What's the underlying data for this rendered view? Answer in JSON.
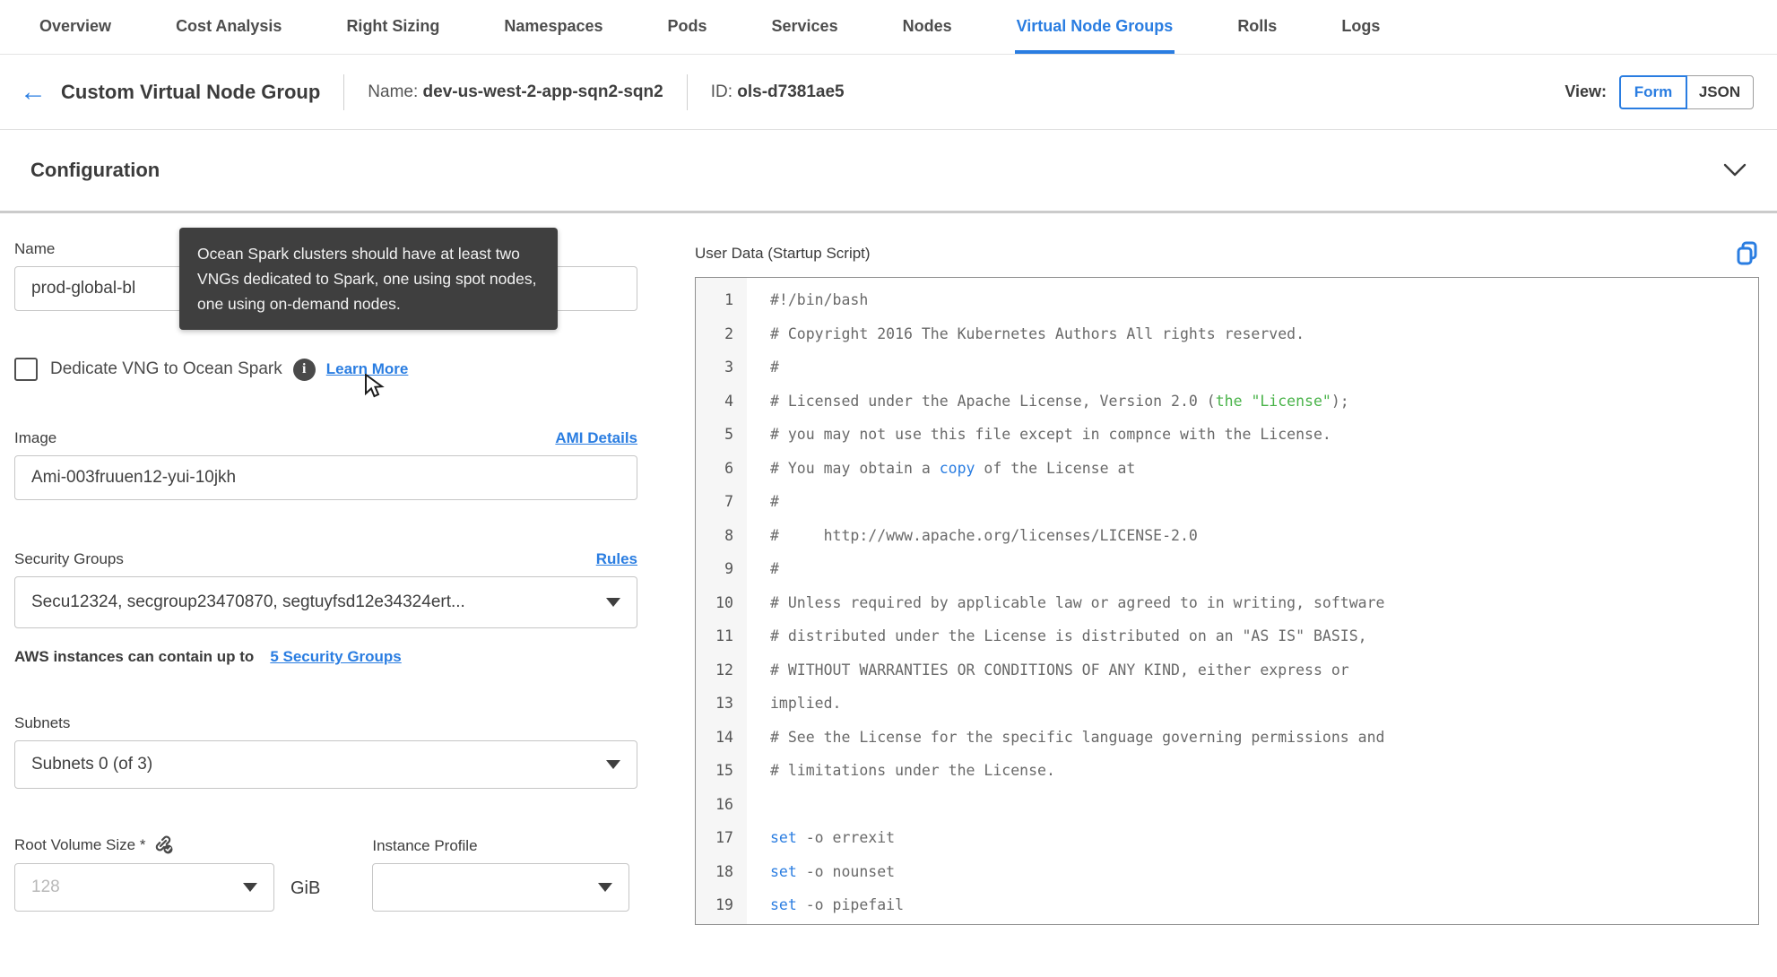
{
  "tabs": {
    "items": [
      {
        "label": "Overview",
        "active": false
      },
      {
        "label": "Cost Analysis",
        "active": false
      },
      {
        "label": "Right Sizing",
        "active": false
      },
      {
        "label": "Namespaces",
        "active": false
      },
      {
        "label": "Pods",
        "active": false
      },
      {
        "label": "Services",
        "active": false
      },
      {
        "label": "Nodes",
        "active": false
      },
      {
        "label": "Virtual Node Groups",
        "active": true
      },
      {
        "label": "Rolls",
        "active": false
      },
      {
        "label": "Logs",
        "active": false
      }
    ]
  },
  "header": {
    "title": "Custom Virtual Node Group",
    "name_label": "Name:",
    "name_value": "dev-us-west-2-app-sqn2-sqn2",
    "id_label": "ID:",
    "id_value": "ols-d7381ae5",
    "view_label": "View:",
    "view_options": [
      {
        "label": "Form",
        "active": true
      },
      {
        "label": "JSON",
        "active": false
      }
    ]
  },
  "section": {
    "title": "Configuration"
  },
  "form": {
    "name": {
      "label": "Name",
      "value": "prod-global-bl"
    },
    "tooltip": {
      "text": "Ocean Spark clusters should have at least two VNGs dedicated to Spark, one using spot nodes, one using on-demand nodes."
    },
    "dedicate": {
      "label": "Dedicate VNG to Ocean Spark",
      "checked": false,
      "link": "Learn More"
    },
    "image": {
      "label": "Image",
      "link": "AMI Details",
      "value": "Ami-003fruuen12-yui-10jkh"
    },
    "security_groups": {
      "label": "Security Groups",
      "link": "Rules",
      "value": "Secu12324, secgroup23470870, segtuyfsd12e34324ert...",
      "helper_text": "AWS instances can contain up to",
      "helper_link": "5 Security Groups"
    },
    "subnets": {
      "label": "Subnets",
      "value": "Subnets 0 (of 3)"
    },
    "root_volume": {
      "label": "Root Volume Size *",
      "placeholder": "128",
      "unit": "GiB"
    },
    "instance_profile": {
      "label": "Instance Profile",
      "value": ""
    }
  },
  "editor": {
    "title": "User Data (Startup Script)",
    "copy_icon": "copy-icon",
    "lines": [
      {
        "n": 1,
        "s": [
          {
            "t": "#!/bin/bash",
            "c": "d"
          }
        ]
      },
      {
        "n": 2,
        "s": [
          {
            "t": "# Copyright 2016 The Kubernetes Authors All rights reserved.",
            "c": "d"
          }
        ]
      },
      {
        "n": 3,
        "s": [
          {
            "t": "#",
            "c": "d"
          }
        ]
      },
      {
        "n": 4,
        "s": [
          {
            "t": "# Licensed under the Apache License, Version 2.0 (",
            "c": "d"
          },
          {
            "t": "the \"License\"",
            "c": "g"
          },
          {
            "t": ");",
            "c": "d"
          }
        ]
      },
      {
        "n": 5,
        "s": [
          {
            "t": "# you may not use this file except in compnce with the License.",
            "c": "d"
          }
        ]
      },
      {
        "n": 6,
        "s": [
          {
            "t": "# You may obtain a ",
            "c": "d"
          },
          {
            "t": "copy",
            "c": "b"
          },
          {
            "t": " of the License at",
            "c": "d"
          }
        ]
      },
      {
        "n": 7,
        "s": [
          {
            "t": "#",
            "c": "d"
          }
        ]
      },
      {
        "n": 8,
        "s": [
          {
            "t": "#     http://www.apache.org/licenses/LICENSE-2.0",
            "c": "d"
          }
        ]
      },
      {
        "n": 9,
        "s": [
          {
            "t": "#",
            "c": "d"
          }
        ]
      },
      {
        "n": 10,
        "s": [
          {
            "t": "# Unless required by applicable law or agreed to in writing, software",
            "c": "d"
          }
        ]
      },
      {
        "n": 11,
        "s": [
          {
            "t": "# distributed under the License is distributed on an \"AS IS\" BASIS,",
            "c": "d"
          }
        ]
      },
      {
        "n": 12,
        "s": [
          {
            "t": "# WITHOUT WARRANTIES OR CONDITIONS OF ANY KIND, either express or",
            "c": "d"
          }
        ]
      },
      {
        "n": 13,
        "s": [
          {
            "t": "implied.",
            "c": "d"
          }
        ]
      },
      {
        "n": 14,
        "s": [
          {
            "t": "# See the License for the specific language governing permissions and",
            "c": "d"
          }
        ]
      },
      {
        "n": 15,
        "s": [
          {
            "t": "# limitations under the License.",
            "c": "d"
          }
        ]
      },
      {
        "n": 16,
        "s": []
      },
      {
        "n": 17,
        "s": [
          {
            "t": "set",
            "c": "b"
          },
          {
            "t": " -o errexit",
            "c": "d"
          }
        ]
      },
      {
        "n": 18,
        "s": [
          {
            "t": "set",
            "c": "b"
          },
          {
            "t": " -o nounset",
            "c": "d"
          }
        ]
      },
      {
        "n": 19,
        "s": [
          {
            "t": "set",
            "c": "b"
          },
          {
            "t": " -o pipefail",
            "c": "d"
          }
        ]
      }
    ]
  },
  "colors": {
    "accent": "#2a7de1",
    "tab_inactive": "#4d4d4d",
    "tooltip_bg": "#3f3f3f",
    "code_green": "#49b349",
    "code_blue": "#2a7de1",
    "code_default": "#696969",
    "gutter_bg": "#f6f6f6"
  },
  "icons": {
    "back": "arrow-left",
    "collapse": "chevron-down",
    "info": "info-circle",
    "root_volume": "link-check",
    "copy": "copy"
  }
}
